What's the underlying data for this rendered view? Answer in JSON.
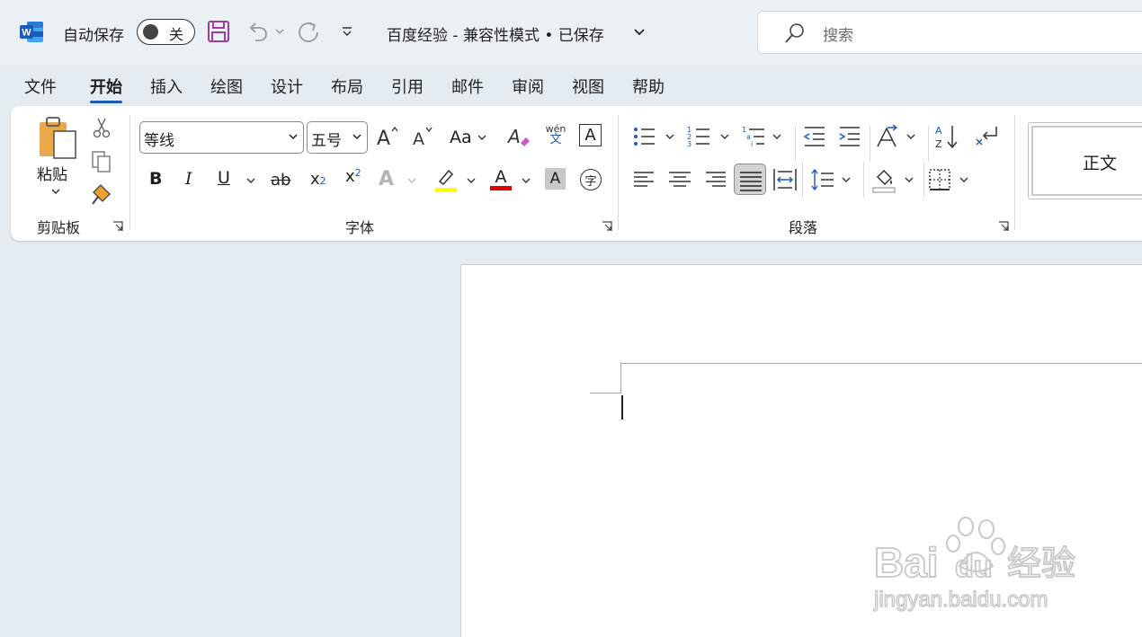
{
  "titlebar": {
    "app_icon": "word-logo",
    "autosave_label": "自动保存",
    "autosave_state": "关",
    "doc_title": "百度经验  -  兼容性模式 • 已保存",
    "search_placeholder": "搜索",
    "quick_access": [
      "save-icon",
      "undo-icon",
      "undo-dropdown-icon",
      "redo-icon",
      "customize-qat-icon"
    ]
  },
  "tabs": [
    {
      "label": "文件",
      "active": false
    },
    {
      "label": "开始",
      "active": true
    },
    {
      "label": "插入",
      "active": false
    },
    {
      "label": "绘图",
      "active": false
    },
    {
      "label": "设计",
      "active": false
    },
    {
      "label": "布局",
      "active": false
    },
    {
      "label": "引用",
      "active": false
    },
    {
      "label": "邮件",
      "active": false
    },
    {
      "label": "审阅",
      "active": false
    },
    {
      "label": "视图",
      "active": false
    },
    {
      "label": "帮助",
      "active": false
    }
  ],
  "ribbon": {
    "clipboard": {
      "group_label": "剪贴板",
      "paste_label": "粘贴"
    },
    "font": {
      "group_label": "字体",
      "font_name": "等线",
      "font_size": "五号",
      "change_case_label": "Aa",
      "phonetic_top": "wén",
      "phonetic_bottom": "文",
      "char_border": "A",
      "bold": "B",
      "italic": "I",
      "underline": "U",
      "strikethrough": "ab",
      "subscript": "x",
      "subscript_index": "2",
      "superscript": "x",
      "superscript_index": "2",
      "text_effects": "A",
      "font_color": "A",
      "char_shading": "A",
      "enclose_char": "字",
      "highlight_color": "#ffff00",
      "font_color_value": "#e00000"
    },
    "paragraph": {
      "group_label": "段落"
    },
    "styles": {
      "normal_label": "正文"
    }
  },
  "watermark": {
    "logo_text": "Bai",
    "logo_text2": "du",
    "brand": "经验",
    "url": "jingyan.baidu.com"
  },
  "colors": {
    "accent": "#1e5ab4",
    "word_blue": "#185abd",
    "save_purple": "#a13ca0"
  }
}
